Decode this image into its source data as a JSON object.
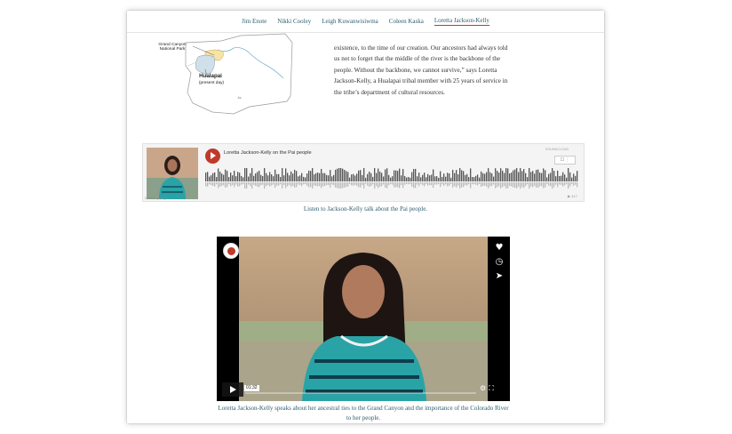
{
  "nav": {
    "items": [
      {
        "label": "Jim Enote"
      },
      {
        "label": "Nikki Cooley"
      },
      {
        "label": "Leigh Kuwanwisiwma"
      },
      {
        "label": "Coleen Kaska"
      },
      {
        "label": "Loretta Jackson-Kelly"
      }
    ],
    "active_index": 4
  },
  "map": {
    "label_grand_canyon": "Grand Canyon National Park",
    "label_hualapai": "Hualapai",
    "label_present_day": "(present day)",
    "label_state": "Az."
  },
  "article": {
    "text": "existence, to the time of our creation. Our ancestors had always told us not to forget that the middle of the river is the backbone of the people. Without the backbone, we cannot survive,” says Loretta Jackson-Kelly, a Hualapai tribal member with 25 years of service in the tribe’s department of cultural resources."
  },
  "audio": {
    "title": "Loretta Jackson-Kelly on the Pai people",
    "brand": "SOUNDCLOUD",
    "play_count": "▶ 417",
    "cookie_label": "Cookie policy",
    "caption": "Listen to Jackson-Kelly talk about the Pai people."
  },
  "video": {
    "timestamp": "01:32",
    "side_icons": [
      "heart-icon",
      "clock-icon",
      "send-icon"
    ],
    "caption": "Loretta Jackson-Kelly speaks about her ancestral ties to the Grand Canyon and the importance of the Colorado River to her people."
  },
  "colors": {
    "link": "#2f5e6e",
    "accent": "#c0392b",
    "text": "#333333"
  }
}
